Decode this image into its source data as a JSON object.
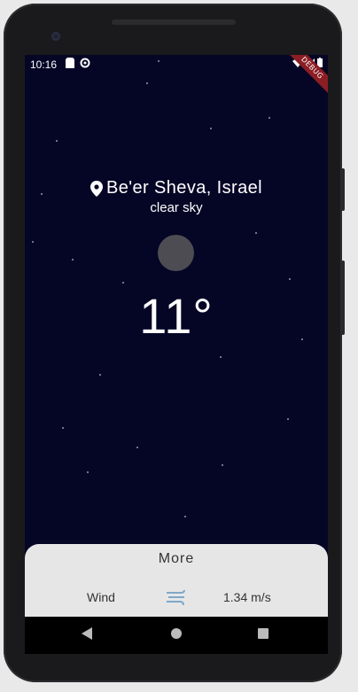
{
  "status_bar": {
    "time": "10:16",
    "debug_label": "DEBUG"
  },
  "weather": {
    "location": "Be'er Sheva, Israel",
    "condition": "clear sky",
    "temperature": "11°",
    "icon": "moon-icon"
  },
  "more_panel": {
    "title": "More",
    "wind_label": "Wind",
    "wind_value": "1.34 m/s",
    "wind_icon": "wind-icon"
  },
  "nav": {
    "back": "back-icon",
    "home": "home-icon",
    "recents": "recents-icon"
  },
  "colors": {
    "sky": "#050626",
    "panel": "#e6e6e7",
    "debug_ribbon": "#8b1d24",
    "moon": "#4c4c52"
  }
}
